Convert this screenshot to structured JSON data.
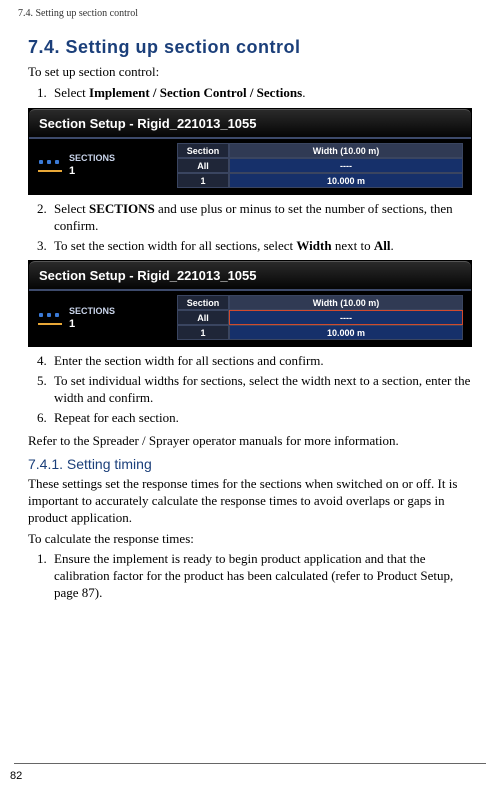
{
  "crumb": "7.4. Setting up section control",
  "h1": "7.4. Setting up section control",
  "intro": "To set up section control:",
  "steps_a": [
    {
      "pre": "Select ",
      "bold": "Implement / Section Control / Sections",
      "post": "."
    }
  ],
  "screenshot1": {
    "title": "Section Setup - Rigid_221013_1055",
    "sections_label": "SECTIONS",
    "sections_count": "1",
    "hdr_section": "Section",
    "hdr_width": "Width (10.00 m)",
    "row_all_label": "All",
    "row_all_val": "----",
    "row_1_label": "1",
    "row_1_val": "10.000 m"
  },
  "steps_b": [
    {
      "pre": "Select ",
      "bold": "SECTIONS",
      "post": " and use plus or minus to set the number of sections, then confirm."
    },
    {
      "pre": "To set the section width for all sections, select ",
      "bold": "Width",
      "mid": " next to ",
      "bold2": "All",
      "post": "."
    }
  ],
  "screenshot2": {
    "title": "Section Setup - Rigid_221013_1055",
    "sections_label": "SECTIONS",
    "sections_count": "1",
    "hdr_section": "Section",
    "hdr_width": "Width (10.00 m)",
    "row_all_label": "All",
    "row_all_val": "----",
    "row_1_label": "1",
    "row_1_val": "10.000 m"
  },
  "steps_c": [
    "Enter the section width for all sections and confirm.",
    "To set individual widths for sections, select the width next to a section, enter the width and confirm.",
    "Repeat for each section."
  ],
  "refer": "Refer to the Spreader / Sprayer operator manuals for more information.",
  "h2": "7.4.1. Setting timing",
  "timing_p1": "These settings set the response times for the sections when switched on or off. It is important to accurately calculate the response times to avoid overlaps or gaps in product application.",
  "timing_p2": "To calculate the response times:",
  "steps_d": [
    "Ensure the implement is ready to begin product application and that the calibration factor for the product has been calculated (refer to Product Setup, page 87)."
  ],
  "page": "82"
}
